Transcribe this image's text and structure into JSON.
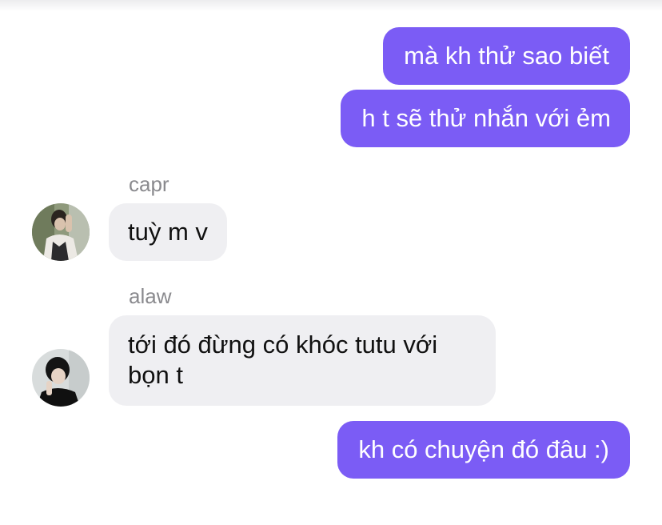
{
  "messages": [
    {
      "direction": "outgoing",
      "text": "mà kh thử sao biết"
    },
    {
      "direction": "outgoing",
      "text": "h t sẽ thử nhắn với ẻm"
    },
    {
      "direction": "incoming",
      "sender": "capr",
      "text": "tuỳ m v",
      "avatar": "avatar-capr"
    },
    {
      "direction": "incoming",
      "sender": "alaw",
      "text_line1": "tới đó đừng có khóc tutu với",
      "text_line2": "bọn t",
      "avatar": "avatar-alaw"
    },
    {
      "direction": "outgoing",
      "text": "kh có chuyện đó đâu :)"
    }
  ],
  "colors": {
    "outgoing_bubble": "#7b5cf5",
    "incoming_bubble": "#efeff2",
    "sender_name": "#8a8a8e"
  }
}
